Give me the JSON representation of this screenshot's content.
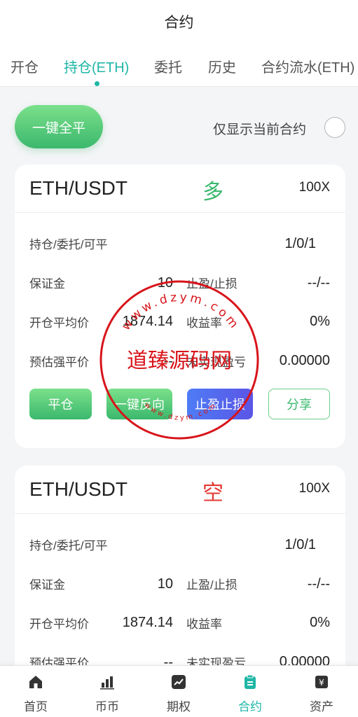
{
  "header": {
    "title": "合约"
  },
  "tabs": [
    {
      "label": "开仓"
    },
    {
      "label": "持仓(ETH)",
      "active": true
    },
    {
      "label": "委托"
    },
    {
      "label": "历史"
    },
    {
      "label": "合约流水(ETH)"
    }
  ],
  "toolbar": {
    "close_all_label": "一键全平",
    "filter_label": "仅显示当前合约"
  },
  "positions": [
    {
      "pair": "ETH/USDT",
      "side": "多",
      "leverage": "100X",
      "holding_label": "持仓/委托/可平",
      "holding_value": "1/0/1",
      "margin_label": "保证金",
      "margin_value": "10",
      "tpsl_label": "止盈/止损",
      "tpsl_value": "--/--",
      "avg_price_label": "开仓平均价",
      "avg_price_value": "1874.14",
      "roi_label": "收益率",
      "roi_value": "0%",
      "liq_label": "预估强平价",
      "liq_value": "--",
      "pnl_label": "未实现盈亏",
      "pnl_value": "0.00000",
      "actions": {
        "close": "平仓",
        "reverse": "一键反向",
        "tpsl": "止盈止损",
        "share": "分享"
      }
    },
    {
      "pair": "ETH/USDT",
      "side": "空",
      "leverage": "100X",
      "holding_label": "持仓/委托/可平",
      "holding_value": "1/0/1",
      "margin_label": "保证金",
      "margin_value": "10",
      "tpsl_label": "止盈/止损",
      "tpsl_value": "--/--",
      "avg_price_label": "开仓平均价",
      "avg_price_value": "1874.14",
      "roi_label": "收益率",
      "roi_value": "0%",
      "liq_label": "预估强平价",
      "liq_value": "--",
      "pnl_label": "未实现盈亏",
      "pnl_value": "0.00000"
    }
  ],
  "watermark": {
    "text": "道臻源码网",
    "ring_text": "www.dzym.com"
  },
  "nav": [
    {
      "label": "首页",
      "icon": "home-icon"
    },
    {
      "label": "币币",
      "icon": "bar-chart-icon"
    },
    {
      "label": "期权",
      "icon": "options-icon"
    },
    {
      "label": "合约",
      "icon": "contract-icon",
      "active": true
    },
    {
      "label": "资产",
      "icon": "wallet-icon"
    }
  ],
  "colors": {
    "accent": "#1fb6a6",
    "long": "#3bb86d",
    "short": "#e53935",
    "watermark": "#d8141a"
  }
}
